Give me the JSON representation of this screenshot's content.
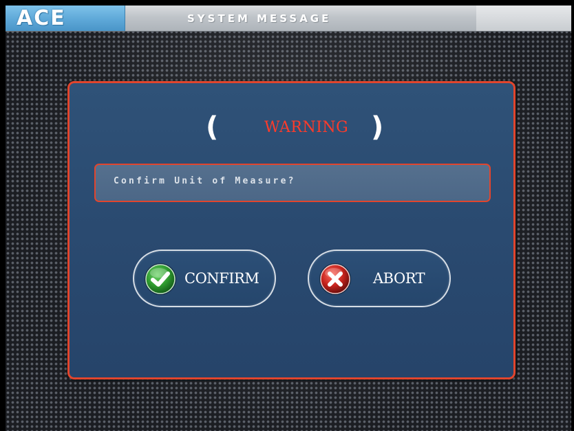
{
  "header": {
    "logo": "ACE",
    "title": "SYSTEM MESSAGE"
  },
  "dialog": {
    "bracket_left": "(",
    "heading": "WARNING",
    "bracket_right": ")",
    "message": "Confirm Unit of Measure?",
    "confirm_label": "CONFIRM",
    "abort_label": "ABORT"
  },
  "icons": {
    "confirm": "check-circle-icon",
    "abort": "x-circle-icon"
  },
  "colors": {
    "accent_red": "#e2452d",
    "dialog_blue": "#2a4a70",
    "warning_text": "#ff3b2a",
    "confirm_green": "#2f9a2f",
    "abort_red": "#c4221c"
  }
}
